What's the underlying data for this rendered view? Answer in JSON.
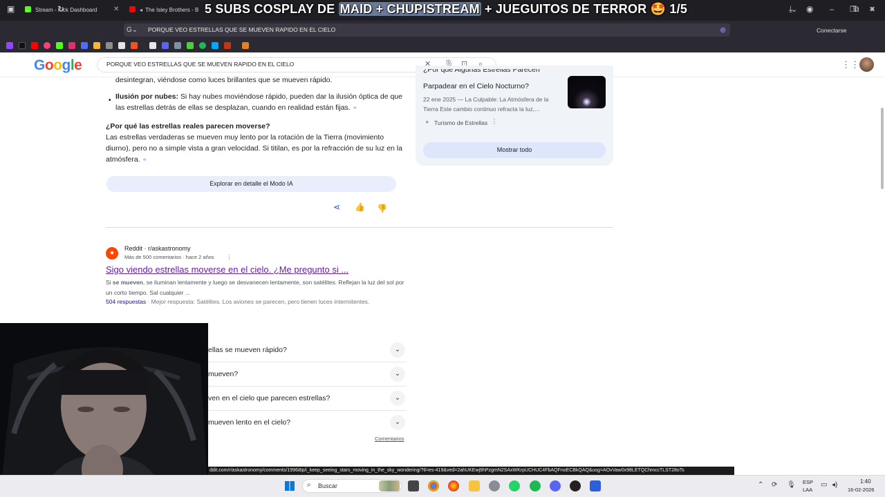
{
  "browser": {
    "tabs": [
      {
        "label": "Stream - Kick Dashboard",
        "icon": "kick-icon",
        "color": "#53fc18"
      },
      {
        "label": "The Isley Brothers - Be",
        "icon": "youtube-icon",
        "color": "#ff0000"
      }
    ],
    "overlay_title_a": "5 SUBS COSPLAY DE ",
    "overlay_title_highlight": "MAID + CHUPISTREAM",
    "overlay_title_b": " + JUEGUITOS DE TERROR 🤩 1/5",
    "address": "PORQUE VEO ESTRELLAS QUE SE MUEVEN RAPIDO EN EL CIELO",
    "account_label": "Conectarse"
  },
  "google": {
    "logo": [
      "G",
      "o",
      "o",
      "g",
      "l",
      "e"
    ],
    "logo_colors": [
      "#4285f4",
      "#ea4335",
      "#fbbc05",
      "#4285f4",
      "#34a853",
      "#ea4335"
    ],
    "query": "PORQUE VEO ESTRELLAS QUE SE MUEVEN RAPIDO EN EL CIELO"
  },
  "ai_overview": {
    "bullet0_tail": "desintegran, viéndose como luces brillantes que se mueven rápido.",
    "bullet1_title": "Ilusión por nubes:",
    "bullet1_text": " Si hay nubes moviéndose rápido, pueden dar la ilusión óptica de que las estrellas detrás de ellas se desplazan, cuando en realidad están fijas.",
    "heading": "¿Por qué las estrellas reales parecen moverse?",
    "paragraph": "Las estrellas verdaderas se mueven muy lento por la rotación de la Tierra (movimiento diurno), pero no a simple vista a gran velocidad. Si titilan, es por la refracción de su luz en la atmósfera.",
    "explore_button": "Explorar en detalle el Modo IA"
  },
  "side_card": {
    "title_partial": "¿Por qué Algunas Estrellas Parecen",
    "title": "Parpadear en el Cielo Nocturno?",
    "snippet": "22 ene 2025 — La Culpable: La Atmósfera de la Tierra Este cambio continuo refracta la luz,...",
    "source": "Turismo de Estrellas",
    "show_all": "Mostrar todo"
  },
  "result": {
    "site": "Reddit",
    "path": "r/askastronomy",
    "meta": "Más de 500 comentarios · hace 2 años",
    "title": "Sigo viendo estrellas moverse en el cielo. ¿Me pregunto si ...",
    "snippet_a": "Si ",
    "snippet_bold": "se mueven",
    "snippet_b": ", se iluminan lentamente y luego se desvanecen lentamente, son satélites. Reflejan la luz del sol por un corto tiempo. Sal cualquier ...",
    "answers_link": "504 respuestas",
    "answers_text": " · Mejor respuesta: Satélites. Los aviones se parecen, pero tienen luces intermitentes."
  },
  "faq": [
    "ellas se mueven rápido?",
    "mueven?",
    "ven en el cielo que parecen estrellas?",
    "mueven lento en el cielo?"
  ],
  "faq_footer": "Comentarios",
  "status_url": "ddit.com/r/askastronomy/comments/1996i8p/i_keep_seeing_stars_moving_in_the_sky_wondering/?tl=es-419&ved=2ahUKEwj9hPzgmN2SAxWKrpUCHUC4FbAQFnoECBkQAQ&usg=AOvVaw0x98LETQChmccTLST28oTs",
  "taskbar": {
    "search_placeholder": "Buscar",
    "lang_line1": "ESP",
    "lang_line2": "LAA",
    "time": "1:40",
    "date": "16-02-2026"
  }
}
